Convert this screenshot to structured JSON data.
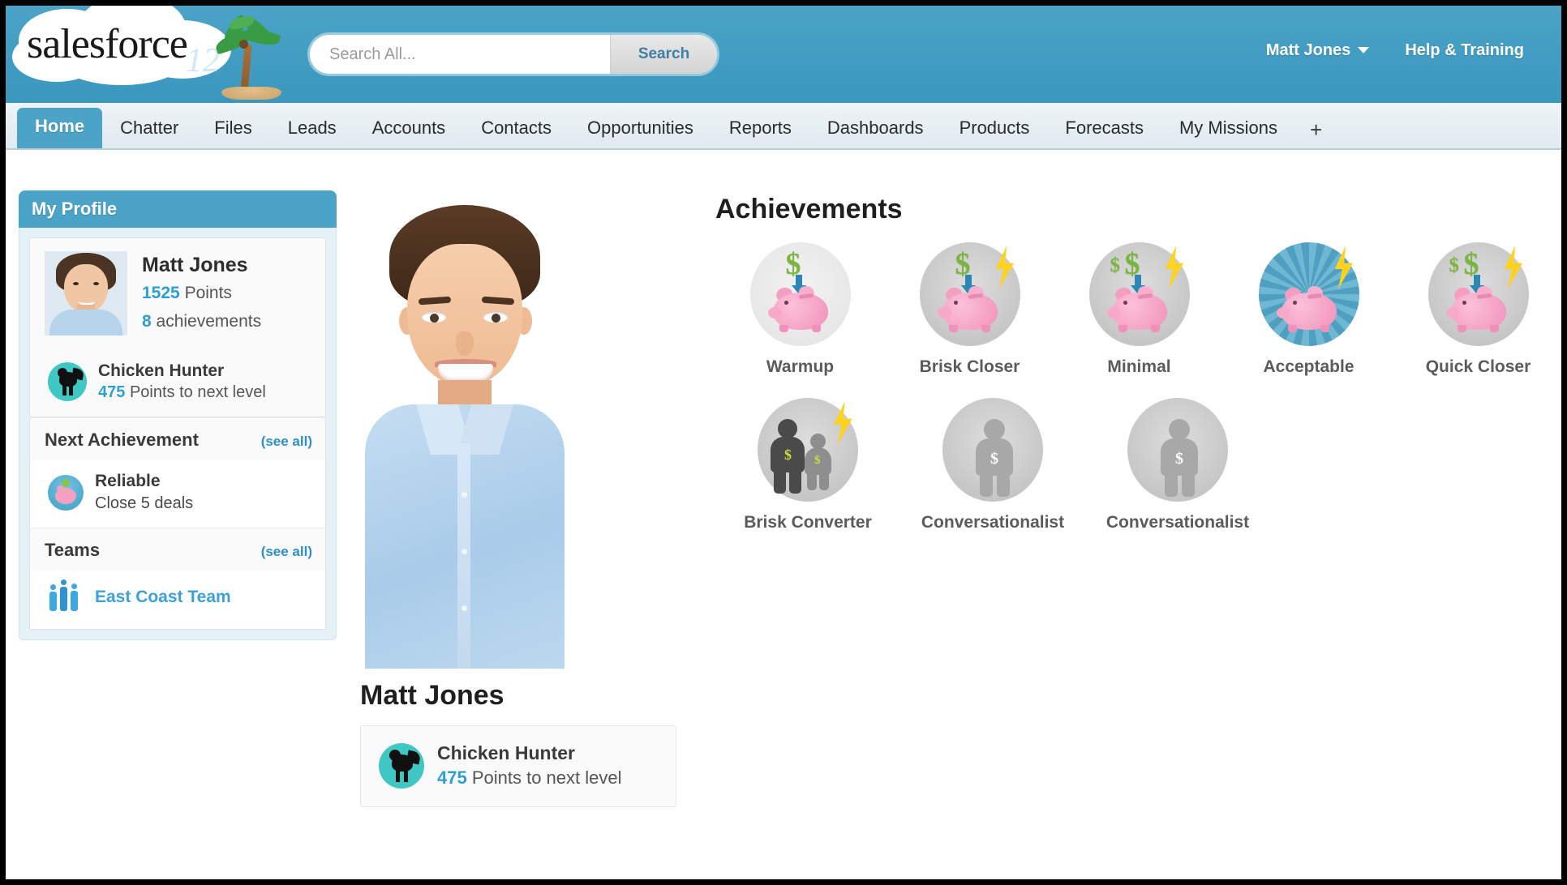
{
  "header": {
    "logo_text": "salesforce",
    "logo_badge": "12",
    "search": {
      "placeholder": "Search All...",
      "value": "",
      "button_label": "Search"
    },
    "user_menu_label": "Matt Jones",
    "help_label": "Help & Training"
  },
  "nav": {
    "tabs": [
      {
        "label": "Home",
        "active": true
      },
      {
        "label": "Chatter",
        "active": false
      },
      {
        "label": "Files",
        "active": false
      },
      {
        "label": "Leads",
        "active": false
      },
      {
        "label": "Accounts",
        "active": false
      },
      {
        "label": "Contacts",
        "active": false
      },
      {
        "label": "Opportunities",
        "active": false
      },
      {
        "label": "Reports",
        "active": false
      },
      {
        "label": "Dashboards",
        "active": false
      },
      {
        "label": "Products",
        "active": false
      },
      {
        "label": "Forecasts",
        "active": false
      },
      {
        "label": "My Missions",
        "active": false
      }
    ],
    "add_tab_label": "+"
  },
  "sidebar": {
    "panel_title": "My Profile",
    "profile": {
      "name": "Matt Jones",
      "points_value": "1525",
      "points_label": "Points",
      "achievements_value": "8",
      "achievements_label": "achievements"
    },
    "level": {
      "title": "Chicken Hunter",
      "points_value": "475",
      "points_label": "Points to next level"
    },
    "next_achievement": {
      "section_title": "Next Achievement",
      "see_all": "(see all)",
      "title": "Reliable",
      "description": "Close 5 deals"
    },
    "teams": {
      "section_title": "Teams",
      "see_all": "(see all)",
      "items": [
        {
          "name": "East Coast Team"
        }
      ]
    }
  },
  "main": {
    "person_name": "Matt Jones",
    "level_card": {
      "title": "Chicken Hunter",
      "points_value": "475",
      "points_label": "Points to next level"
    }
  },
  "achievements": {
    "title": "Achievements",
    "row1": [
      {
        "label": "Warmup",
        "style": "plain",
        "bolt": false,
        "dollars": 1
      },
      {
        "label": "Brisk Closer",
        "style": "locked",
        "bolt": true,
        "dollars": 1
      },
      {
        "label": "Minimal",
        "style": "locked",
        "bolt": true,
        "dollars": 2
      },
      {
        "label": "Acceptable",
        "style": "blue",
        "bolt": true,
        "dollars": 0
      },
      {
        "label": "Quick Closer",
        "style": "locked",
        "bolt": true,
        "dollars": 2
      }
    ],
    "row2": [
      {
        "label": "Brisk Converter",
        "style": "locked",
        "bolt": true,
        "people": 2
      },
      {
        "label": "Conversationalist",
        "style": "locked",
        "bolt": false,
        "people": 1
      },
      {
        "label": "Conversationalist",
        "style": "locked",
        "bolt": false,
        "people": 1
      }
    ]
  },
  "colors": {
    "brand_blue": "#4ba3c7",
    "link_blue": "#2f9fd0",
    "panel_bg": "#e4f2f8",
    "gold": "#ffd21e",
    "teal": "#3fc7c4",
    "dollar_green": "#79b63d"
  }
}
